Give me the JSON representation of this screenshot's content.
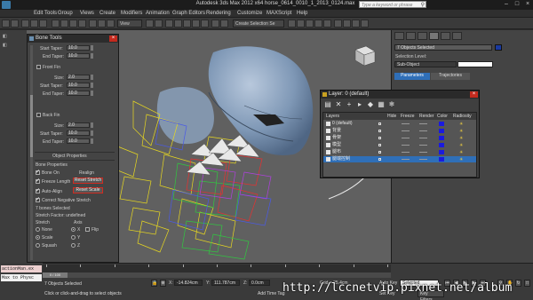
{
  "titlebar": {
    "app_title": "Autodesk 3ds Max  2012 x64    horse_0614_0010_1_2013_0124.max",
    "search_placeholder": "Type a keyword or phrase"
  },
  "menubar": [
    "Edit",
    "Tools",
    "Group",
    "Views",
    "Create",
    "Modifiers",
    "Animation",
    "Graph Editors",
    "Rendering",
    "Customize",
    "MAXScript",
    "Help"
  ],
  "toolbar": {
    "view_dropdown": "View",
    "named_sel_dropdown": "Create Selection Se"
  },
  "bone_tools": {
    "title": "Bone Tools",
    "fields": {
      "start_taper_1": {
        "label": "Start Taper:",
        "value": "10.0"
      },
      "end_taper_1": {
        "label": "End Taper:",
        "value": "10.0"
      },
      "front_fin": "Front Fin",
      "ff_size": {
        "label": "Size:",
        "value": "2.0"
      },
      "ff_start_taper": {
        "label": "Start Taper:",
        "value": "10.0"
      },
      "ff_end_taper": {
        "label": "End Taper:",
        "value": "10.0"
      },
      "back_fin": "Back Fin",
      "bf_size": {
        "label": "Size:",
        "value": "2.0"
      },
      "bf_start_taper": {
        "label": "Start Taper:",
        "value": "10.0"
      },
      "bf_end_taper": {
        "label": "End Taper:",
        "value": "10.0"
      }
    },
    "object_properties": {
      "header": "Object Properties",
      "bone_properties": "Bone Properties",
      "bone_on": "Bone On",
      "realign": "Realign",
      "freeze_length": "Freeze Length",
      "reset_stretch": "Reset Stretch",
      "auto_align": "Auto-Align",
      "reset_scale": "Reset Scale",
      "correct_negative_stretch": "Correct Negative Stretch",
      "bones_selected": "7 bones Selected",
      "stretch_factor": "Stretch Factor: undefined",
      "stretch_label": "Stretch",
      "axis_label": "Axis",
      "stretch_options": [
        "None",
        "Scale",
        "Squash"
      ],
      "axis_options": [
        "X",
        "Y",
        "Z"
      ],
      "stretch_selected": "Scale",
      "axis_selected": "X",
      "flip": "Flip"
    }
  },
  "command_panel": {
    "object_name": "7 Objects Selected",
    "selection_level_label": "Selection Level:",
    "selection_level_value": "Sub-Object",
    "tabs": [
      "Parameters",
      "Trajectories"
    ]
  },
  "layer_dialog": {
    "title": "Layer: 0 (default)",
    "columns": [
      "Layers",
      "Hide",
      "Freeze",
      "Render",
      "Color",
      "Radiosity"
    ],
    "rows": [
      {
        "name": "0 (default)",
        "selected": false
      },
      {
        "name": "背景",
        "selected": false
      },
      {
        "name": "骨架",
        "selected": false
      },
      {
        "name": "模型",
        "selected": false
      },
      {
        "name": "腿布",
        "selected": false
      },
      {
        "name": "腿端控制",
        "selected": true
      }
    ],
    "colors": {
      "row_color": "#1a1ae0",
      "selected_bg": "#2f6fb8"
    }
  },
  "statusbar": {
    "objects_selected": "7 Objects Selected",
    "prompt": "Click or click-and-drag to select objects",
    "x_label": "X:",
    "x_value": "-14.824cm",
    "y_label": "Y:",
    "y_value": "111.787cm",
    "z_label": "Z:",
    "z_value": "0.0cm",
    "grid": "Grid = 25.4cm",
    "add_time_tag": "Add Time Tag",
    "auto_key": "Auto Key",
    "set_key": "Set Key",
    "key_mode": "Selected",
    "key_filters": "Key Filters...",
    "time_display": "0 / 100",
    "timeline_ticks": [
      "0",
      "10",
      "20",
      "30",
      "40",
      "50",
      "60",
      "70",
      "80",
      "90",
      "100"
    ]
  },
  "maxscript": {
    "line1": "actionMan.ex",
    "line2": "Max to Physc"
  },
  "watermark": "http://lccnetvip.pixnet.net/album"
}
